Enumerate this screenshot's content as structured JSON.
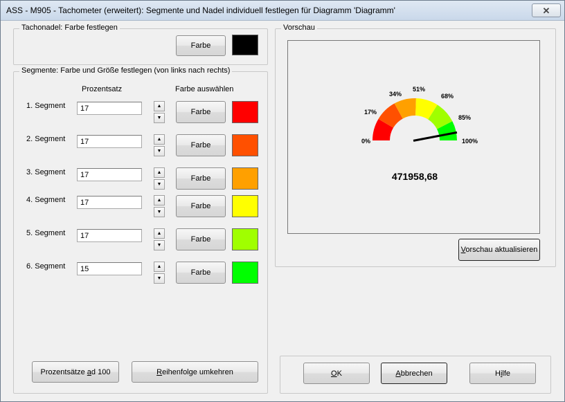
{
  "window": {
    "title": "ASS - M905 - Tachometer (erweitert): Segmente und Nadel individuell festlegen für Diagramm 'Diagramm'",
    "close_label": "✕"
  },
  "needle_group": {
    "label": "Tachonadel: Farbe festlegen",
    "button_label": "Farbe",
    "color": "#000000"
  },
  "segments_group": {
    "label": "Segmente: Farbe und Größe festlegen (von links nach rechts)",
    "col_percent": "Prozentsatz",
    "col_color": "Farbe auswählen",
    "button_label": "Farbe",
    "segments": [
      {
        "label": "1. Segment",
        "value": "17",
        "color": "#ff0000"
      },
      {
        "label": "2. Segment",
        "value": "17",
        "color": "#ff5000"
      },
      {
        "label": "3. Segment",
        "value": "17",
        "color": "#ffa000"
      },
      {
        "label": "4. Segment",
        "value": "17",
        "color": "#ffff00"
      },
      {
        "label": "5. Segment",
        "value": "17",
        "color": "#a0ff00"
      },
      {
        "label": "6. Segment",
        "value": "15",
        "color": "#00ff00"
      }
    ],
    "btn_percent_100_pre": "Prozentsätze ",
    "btn_percent_100_u": "a",
    "btn_percent_100_post": "d 100",
    "btn_reverse_u": "R",
    "btn_reverse_post": "eihenfolge umkehren"
  },
  "preview_group": {
    "label": "Vorschau",
    "gauge_labels": [
      "0%",
      "17%",
      "34%",
      "51%",
      "68%",
      "85%",
      "100%"
    ],
    "gauge_value": "471958,68",
    "needle_fraction": 0.94,
    "update_u": "V",
    "update_post": "orschau aktualisieren"
  },
  "footer": {
    "ok_u": "O",
    "ok_post": "K",
    "cancel_u": "A",
    "cancel_post": "bbrechen",
    "help_pre": "H",
    "help_u": "i",
    "help_post": "lfe"
  }
}
